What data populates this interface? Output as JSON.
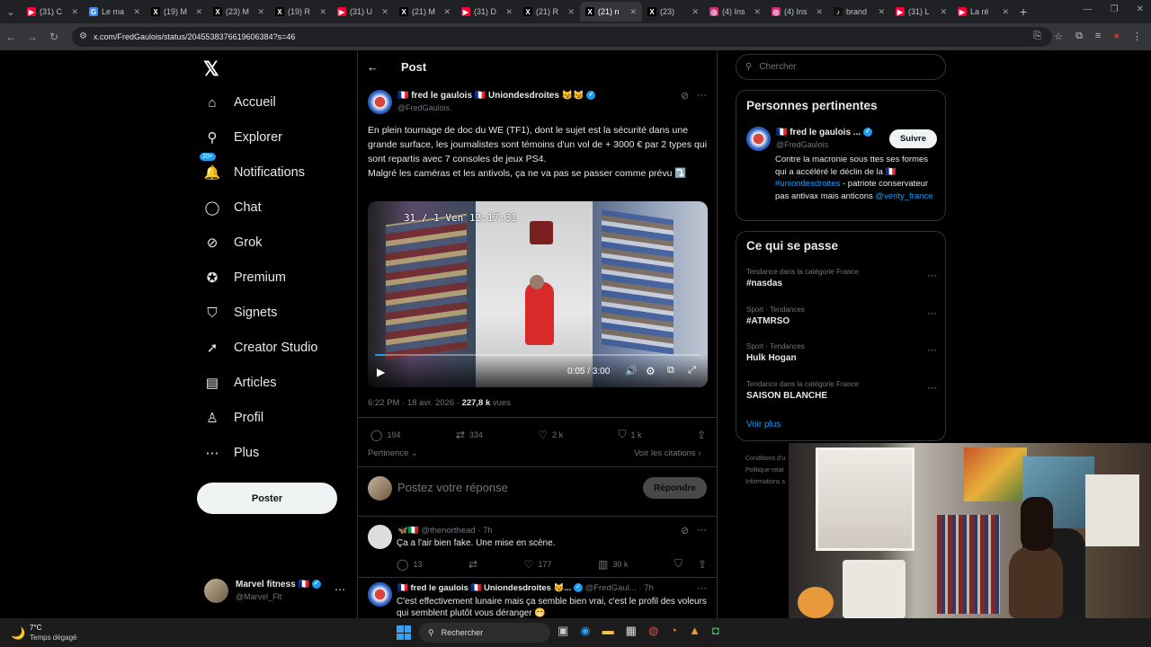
{
  "browser": {
    "tabs": [
      {
        "title": "(31) C",
        "color": "#ff0033",
        "glyph": "▶"
      },
      {
        "title": "Le ma",
        "color": "#4285f4",
        "glyph": "G"
      },
      {
        "title": "(19) M",
        "color": "#000000",
        "glyph": "X"
      },
      {
        "title": "(23) M",
        "color": "#000000",
        "glyph": "X"
      },
      {
        "title": "(19) R",
        "color": "#000000",
        "glyph": "X"
      },
      {
        "title": "(31) U",
        "color": "#ff0033",
        "glyph": "▶"
      },
      {
        "title": "(21) M",
        "color": "#000000",
        "glyph": "X"
      },
      {
        "title": "(31) D",
        "color": "#ff0033",
        "glyph": "▶"
      },
      {
        "title": "(21) R",
        "color": "#000000",
        "glyph": "X"
      },
      {
        "title": "(21) n",
        "color": "#000000",
        "glyph": "X",
        "active": true
      },
      {
        "title": "(23)",
        "color": "#000000",
        "glyph": "X"
      },
      {
        "title": "(4) Ins",
        "color": "#d62976",
        "glyph": "◎"
      },
      {
        "title": "(4) Ins",
        "color": "#d62976",
        "glyph": "◎"
      },
      {
        "title": "brand",
        "color": "#111111",
        "glyph": "♪"
      },
      {
        "title": "(31) L",
        "color": "#ff0033",
        "glyph": "▶"
      },
      {
        "title": "La ré",
        "color": "#ff0033",
        "glyph": "▶"
      }
    ],
    "url": "x.com/FredGaulois/status/2045538376619606384?s=46"
  },
  "nav": {
    "items": [
      {
        "label": "Accueil",
        "icon": "home-icon",
        "glyph": "⌂"
      },
      {
        "label": "Explorer",
        "icon": "search-icon",
        "glyph": "⚲"
      },
      {
        "label": "Notifications",
        "icon": "bell-icon",
        "glyph": "🔔",
        "badge": "20+"
      },
      {
        "label": "Chat",
        "icon": "chat-icon",
        "glyph": "◯"
      },
      {
        "label": "Grok",
        "icon": "grok-icon",
        "glyph": "⊘"
      },
      {
        "label": "Premium",
        "icon": "premium-icon",
        "glyph": "✪"
      },
      {
        "label": "Signets",
        "icon": "bookmark-icon",
        "glyph": "⛉"
      },
      {
        "label": "Creator Studio",
        "icon": "rocket-icon",
        "glyph": "➚"
      },
      {
        "label": "Articles",
        "icon": "article-icon",
        "glyph": "▤"
      },
      {
        "label": "Profil",
        "icon": "profile-icon",
        "glyph": "♙"
      },
      {
        "label": "Plus",
        "icon": "more-icon",
        "glyph": "⋯"
      }
    ],
    "post_button": "Poster",
    "account": {
      "name": "Marvel fitness 🇫🇷",
      "handle": "@Marvel_Flt"
    }
  },
  "post": {
    "header": "Post",
    "author": "🇫🇷 fred le gaulois 🇫🇷 Uniondesdroites 😼😼",
    "handle": "@FredGaulois",
    "text": "En plein tournage de doc du WE (TF1), dont le sujet est la sécurité dans une grande surface, les journalistes sont témoins d'un vol de + 3000 € par 2 types qui sont repartis avec 7 consoles de jeux PS4.\nMalgré les caméras et les antivols, ça ne va pas se passer comme prévu ⤵️",
    "video": {
      "overlay": "31 / 1 Ven 12:17:31",
      "time": "0:05 / 3:00",
      "progress": 0.028
    },
    "meta_time": "6:22 PM · 18 avr. 2026 · ",
    "views": "227,8 k",
    "views_label": " vues",
    "stats": {
      "replies": "194",
      "reposts": "334",
      "likes": "2 k",
      "bookmarks": "1 k"
    },
    "sort": "Pertinence",
    "quotes": "Voir les citations",
    "reply_placeholder": "Postez votre réponse",
    "reply_button": "Répondre"
  },
  "replies": [
    {
      "author": "🦋🇮🇹",
      "handle": "@thenorthead · 7h",
      "text": "Ça a l'air bien fake. Une mise en scène.",
      "stats": {
        "replies": "13",
        "reposts": "",
        "likes": "177",
        "views": "30 k"
      }
    },
    {
      "author": "🇫🇷 fred le gaulois 🇫🇷 Uniondesdroites 😼...",
      "handle": "@FredGaul... · 7h",
      "text": "C'est effectivement lunaire mais ça semble bien vrai, c'est le profil des voleurs qui semblent plutôt vous déranger 😁"
    }
  ],
  "sidebar": {
    "search_placeholder": "Chercher",
    "relevant": {
      "title": "Personnes pertinentes",
      "name": "🇫🇷 fred le gaulois ...",
      "handle": "@FredGaulois",
      "follow": "Suivre",
      "bio": "Contre la macronie sous ttes ses formes qui a accéléré le déclin de la 🇫🇷",
      "hashtag": "#uniondesdroites",
      "bio2": " - patriote conservateur pas antivax mais anticons ",
      "mention": "@verity_france"
    },
    "trends": {
      "title": "Ce qui se passe",
      "items": [
        {
          "category": "Tendance dans la catégorie France",
          "name": "#nasdas"
        },
        {
          "category": "Sport · Tendances",
          "name": "#ATMRSO"
        },
        {
          "category": "Sport · Tendances",
          "name": "Hulk Hogan"
        },
        {
          "category": "Tendance dans la catégorie France",
          "name": "SAISON BLANCHE"
        }
      ],
      "more": "Voir plus"
    },
    "footer": [
      "Conditions d'u",
      "Politique relat",
      "Informations s"
    ]
  },
  "taskbar": {
    "weather_temp": "7°C",
    "weather_desc": "Temps dégagé",
    "search": "Rechercher"
  }
}
